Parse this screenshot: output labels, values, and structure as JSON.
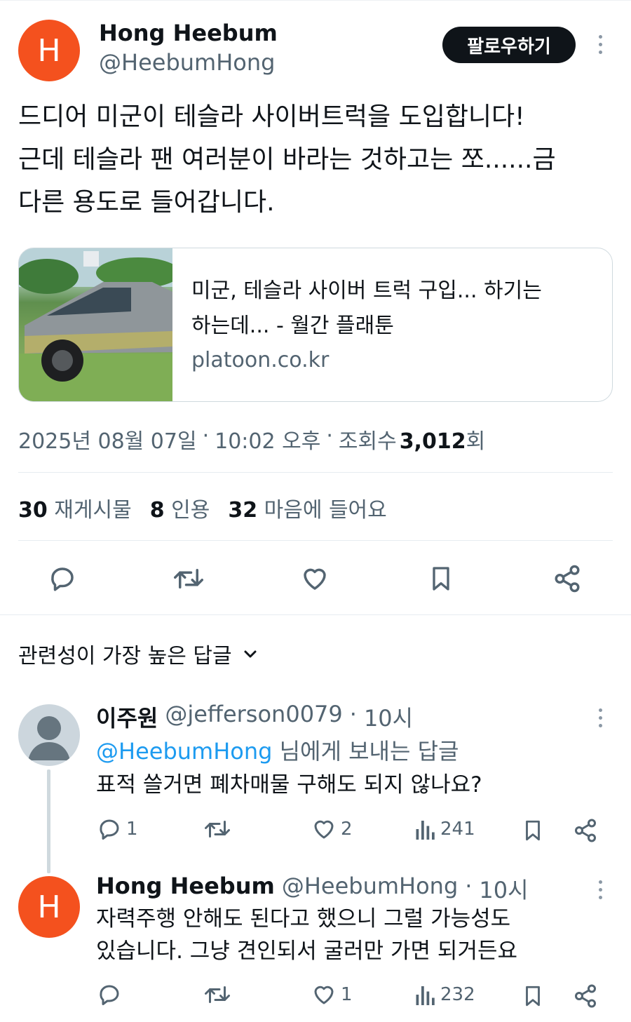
{
  "colors": {
    "avatar_orange": "#f4511e",
    "follow_bg": "#0f1419",
    "link_blue": "#1d9bf0",
    "muted": "#536471"
  },
  "tweet": {
    "avatar_letter": "H",
    "display_name": "Hong Heebum",
    "handle": "@HeebumHong",
    "follow_label": "팔로우하기",
    "text_lines": [
      "드디어 미군이 테슬라 사이버트럭을 도입합니다!",
      "근데 테슬라 팬 여러분이 바라는 것하고는 쪼......금",
      "다른 용도로 들어갑니다."
    ],
    "link_card": {
      "title_lines": [
        "미군, 테슬라 사이버 트럭 구입... 하기는",
        "하는데... - 월간 플래툰"
      ],
      "domain": "platoon.co.kr"
    },
    "meta": {
      "date": "2025년 08월 07일",
      "sep1": "·",
      "time": "10:02 오후",
      "sep2": "·",
      "views_prefix": "조회수",
      "views_count": "3,012",
      "views_suffix": "회"
    },
    "stats": {
      "reposts_count": "30",
      "reposts_label": "재게시물",
      "quotes_count": "8",
      "quotes_label": "인용",
      "likes_count": "32",
      "likes_label": "마음에 들어요"
    }
  },
  "replies_sort": {
    "label": "관련성이 가장 높은 답글"
  },
  "replies": [
    {
      "display_name": "이주원",
      "handle": "@jefferson0079",
      "sep": "·",
      "time": "10시",
      "replying_to_handle": "@HeebumHong",
      "replying_to_suffix": "님에게 보내는 답글",
      "text_lines": [
        "표적 쓸거면 폐차매물 구해도 되지 않나요?"
      ],
      "reply_count": "1",
      "repost_count": "",
      "like_count": "2",
      "view_count": "241"
    },
    {
      "avatar_letter": "H",
      "display_name": "Hong Heebum",
      "handle": "@HeebumHong",
      "sep": "·",
      "time": "10시",
      "text_lines": [
        "자력주행 안해도 된다고 했으니 그럴 가능성도",
        "있습니다. 그냥 견인되서 굴러만 가면 되거든요"
      ],
      "reply_count": "",
      "repost_count": "",
      "like_count": "1",
      "view_count": "232"
    }
  ]
}
